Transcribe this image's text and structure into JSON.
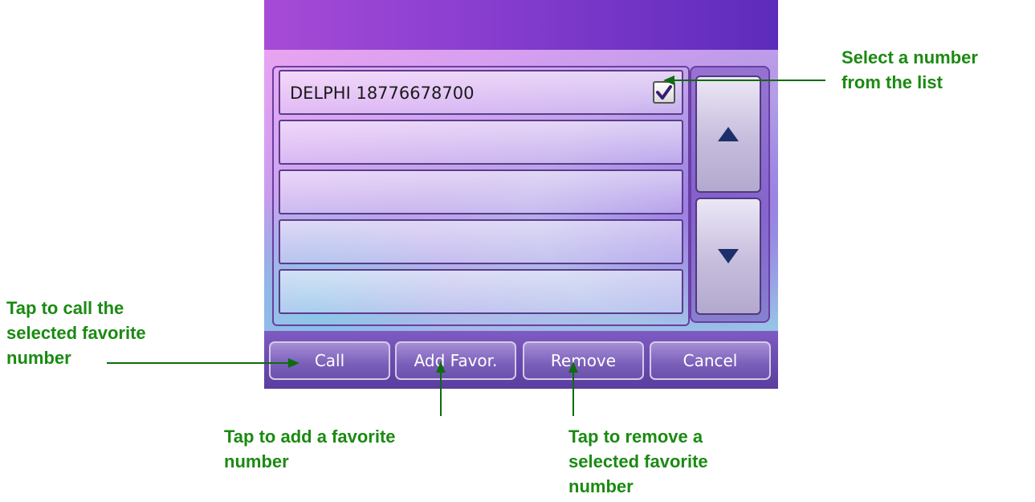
{
  "dialog": {
    "list_items": [
      {
        "label": "DELPHI 18776678700",
        "checked": true
      },
      {
        "label": "",
        "checked": false
      },
      {
        "label": "",
        "checked": false
      },
      {
        "label": "",
        "checked": false
      },
      {
        "label": "",
        "checked": false
      }
    ],
    "buttons": {
      "call": "Call",
      "add_favorite": "Add Favor.",
      "remove": "Remove",
      "cancel": "Cancel"
    },
    "scroll": {
      "up_icon": "triangle-up-icon",
      "down_icon": "triangle-down-icon"
    }
  },
  "callouts": {
    "select_number": "Select a number\nfrom the list",
    "call": "Tap to call the\nselected favorite\nnumber",
    "add_favorite": "Tap to add a favorite\nnumber",
    "remove": "Tap to remove a\nselected favorite\nnumber"
  },
  "colors": {
    "callout_text": "#1b8a12",
    "callout_line": "#0f6b0f",
    "header_bar": "#8a3ed0"
  }
}
